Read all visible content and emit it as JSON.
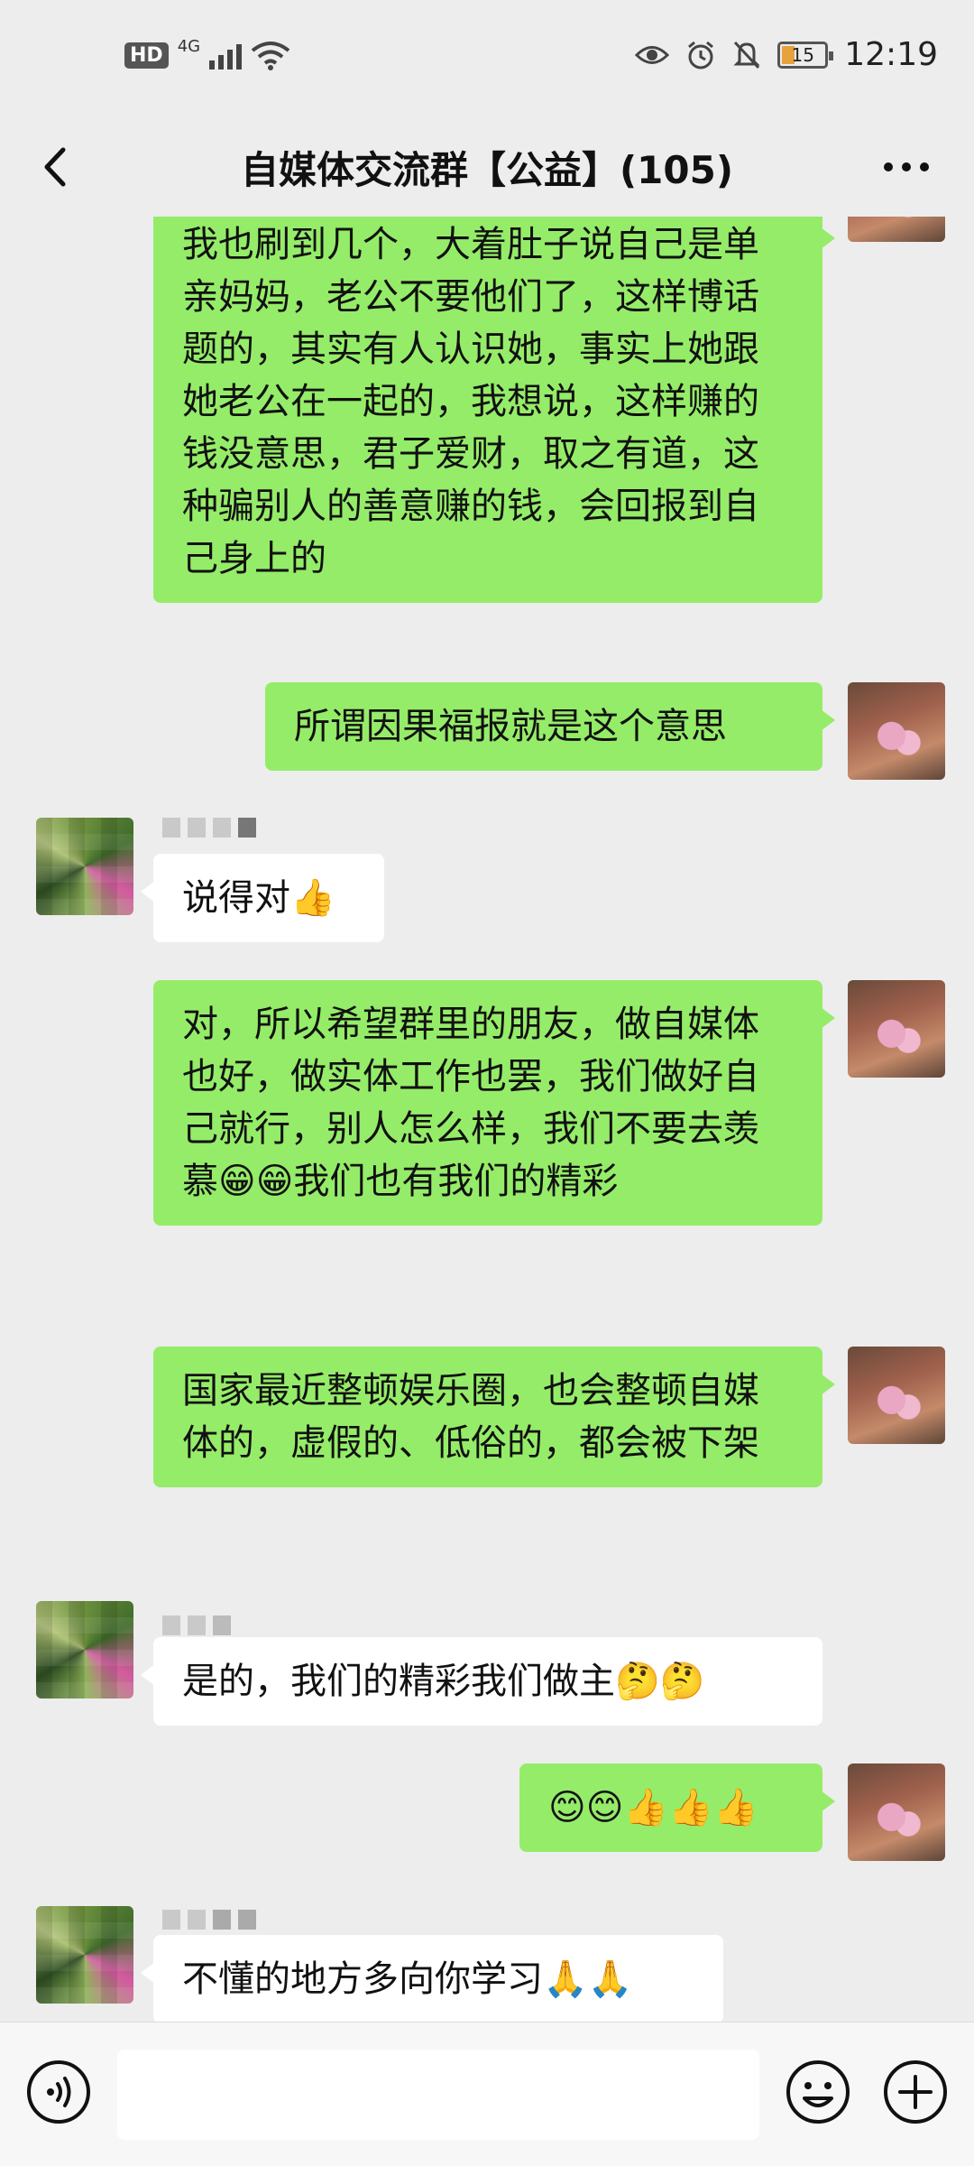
{
  "status_bar": {
    "hd": "HD",
    "network": "4G",
    "time": "12:19",
    "battery": "15"
  },
  "nav": {
    "title": "自媒体交流群【公益】(105)"
  },
  "messages": [
    {
      "sender": "self",
      "text": "我也刷到几个，大着肚子说自己是单亲妈妈，老公不要他们了，这样博话题的，其实有人认识她，事实上她跟她老公在一起的，我想说，这样赚的钱没意思，君子爱财，取之有道，这种骗别人的善意赚的钱，会回报到自己身上的"
    },
    {
      "sender": "self",
      "text": "所谓因果福报就是这个意思"
    },
    {
      "sender": "other",
      "text": "说得对👍"
    },
    {
      "sender": "self",
      "text": "对，所以希望群里的朋友，做自媒体也好，做实体工作也罢，我们做好自己就行，别人怎么样，我们不要去羡慕😁😁我们也有我们的精彩"
    },
    {
      "sender": "self",
      "text": "国家最近整顿娱乐圈，也会整顿自媒体的，虚假的、低俗的，都会被下架"
    },
    {
      "sender": "other",
      "text": "是的，我们的精彩我们做主🤔🤔"
    },
    {
      "sender": "self",
      "text": "😊😊👍👍👍"
    },
    {
      "sender": "other",
      "text": "不懂的地方多向你学习🙏🙏"
    }
  ],
  "input": {
    "placeholder": ""
  },
  "colors": {
    "self_bubble": "#95ec69",
    "other_bubble": "#ffffff",
    "background": "#ededed"
  }
}
